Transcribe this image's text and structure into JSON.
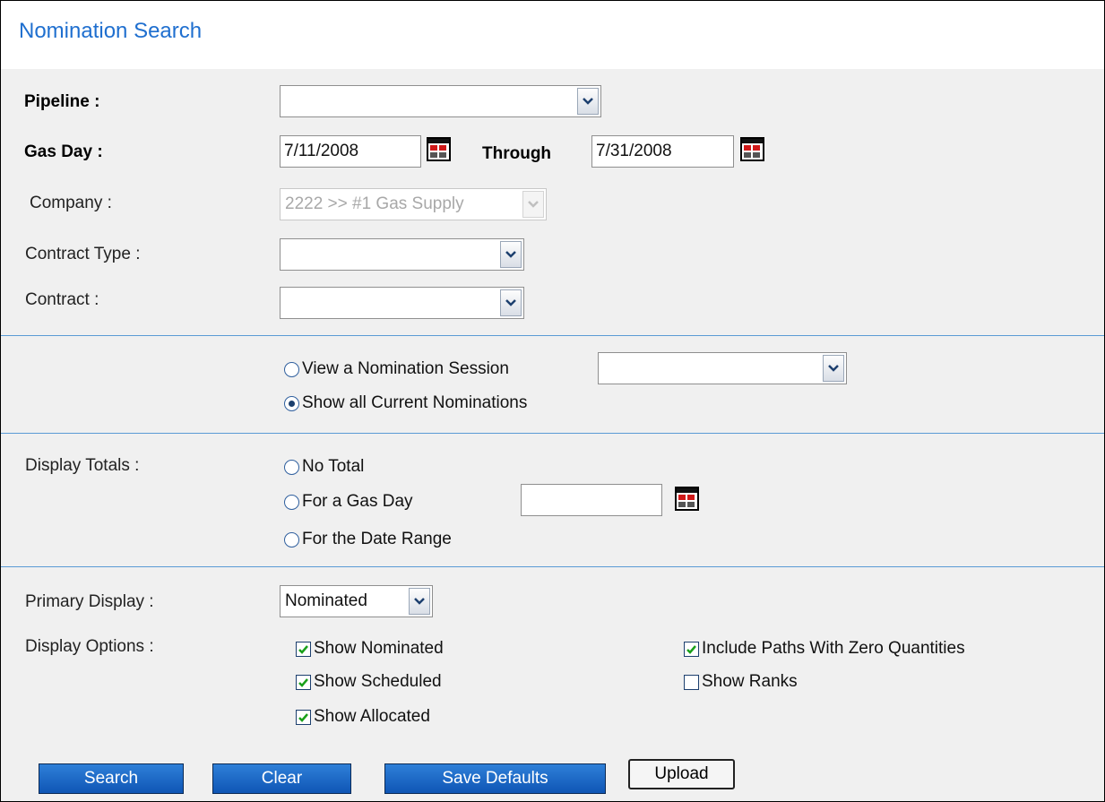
{
  "page": {
    "title": "Nomination Search"
  },
  "pipeline": {
    "label": "Pipeline :",
    "value": ""
  },
  "gas_day": {
    "label": "Gas Day :",
    "from": "7/11/2008",
    "through_label": "Through",
    "to": "7/31/2008"
  },
  "company": {
    "label": "Company :",
    "value": "2222 >> #1 Gas Supply"
  },
  "contract_type": {
    "label": "Contract Type :",
    "value": ""
  },
  "contract": {
    "label": "Contract :",
    "value": ""
  },
  "session": {
    "view_label": "View a Nomination Session",
    "view_value": "",
    "show_all_label": "Show all Current Nominations",
    "selected": "show_all"
  },
  "display_totals": {
    "label": "Display Totals :",
    "no_total": "No Total",
    "gas_day": "For a Gas Day",
    "gas_day_value": "",
    "date_range": "For the Date Range"
  },
  "primary_display": {
    "label": "Primary Display :",
    "value": "Nominated"
  },
  "display_options": {
    "label": "Display Options :",
    "show_nominated": "Show Nominated",
    "show_scheduled": "Show Scheduled",
    "show_allocated": "Show Allocated",
    "include_zero": "Include Paths With Zero Quantities",
    "show_ranks": "Show Ranks"
  },
  "buttons": {
    "search": "Search",
    "clear": "Clear",
    "save_defaults": "Save Defaults",
    "upload": "Upload"
  },
  "icons": {
    "calendar": "calendar-icon",
    "dropdown": "chevron-down-icon",
    "checkbox": "checkmark-icon"
  },
  "colors": {
    "title": "#1f6fcf",
    "button_blue": "#1a66c6",
    "separator": "#5b9bd5",
    "check": "#1aa01a"
  }
}
